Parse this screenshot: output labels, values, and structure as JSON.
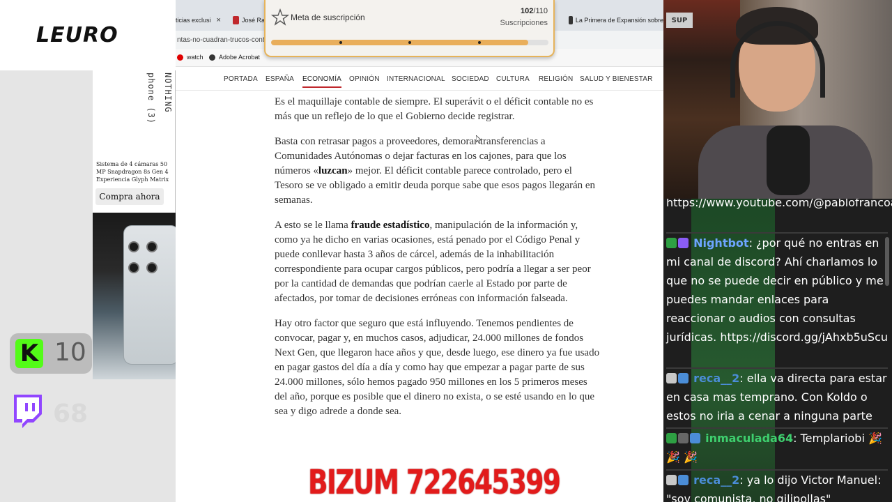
{
  "overlay": {
    "logo": "LEURO",
    "ad": {
      "vertical_text_1": "phone (3)",
      "vertical_text_2": "NOTHING",
      "description": "Sistema de 4 cámaras 50 MP Snapdragon 8s Gen 4 Experiencia Glyph Matrix",
      "cta": "Compra ahora"
    },
    "kick": {
      "icon": "kick-logo",
      "letter": "K",
      "count": "10",
      "color": "#53fc18"
    },
    "twitch": {
      "icon": "twitch-logo",
      "count": "68",
      "color": "#9146ff"
    },
    "bizum": "BIZUM 722645399"
  },
  "browser": {
    "tabs": [
      {
        "label": "ticias exclusi",
        "close": "×"
      },
      {
        "label": "José Ra",
        "favicon_color": "#c0282d"
      },
      {
        "label": "La Primera de Expansión sobre",
        "favicon_color": "#333333"
      }
    ],
    "url": "ntas-no-cuadran-trucos-contab",
    "bookmarks": [
      {
        "label": "watch",
        "icon": "youtube-icon",
        "color": "#e00000"
      },
      {
        "label": "Adobe Acrobat",
        "icon": "acrobat-icon",
        "color": "#333333"
      }
    ]
  },
  "site_nav": [
    "PORTADA",
    "ESPAÑA",
    "ECONOMÍA",
    "OPINIÓN",
    "INTERNACIONAL",
    "SOCIEDAD",
    "CULTURA",
    "RELIGIÓN",
    "SALUD Y BIENESTAR"
  ],
  "site_nav_active": "ECONOMÍA",
  "article": {
    "p1": "Es el maquillaje contable de siempre. El superávit o el déficit contable no es más que un reflejo de lo que el Gobierno decide registrar.",
    "p2_a": "Basta con retrasar pagos a proveedores, demorar transferencias a Comunidades Autónomas o dejar facturas en los cajones, para que los números «",
    "p2_b": "luzcan",
    "p2_c": "» mejor. El déficit contable parece controlado, pero el Tesoro se ve obligado a emitir deuda porque sabe que esos pagos llegarán en semanas.",
    "p3_a": "A esto se le llama ",
    "p3_b": "fraude estadístico",
    "p3_c": ", manipulación de la información y, como ya he dicho en varias ocasiones, está penado por el Código Penal y puede conllevar hasta 3 años de cárcel, además de la inhabilitación correspondiente para ocupar cargos públicos, pero podría a llegar a ser peor por la cantidad de demandas que podrían caerle al Estado por parte de afectados, por tomar de decisiones erróneas con información falseada.",
    "p4": "Hay otro factor que seguro que está influyendo. Tenemos pendientes de convocar, pagar y, en muchos casos, adjudicar, 24.000 millones de fondos Next Gen, que llegaron hace años y que, desde luego, ese dinero ya fue usado en pagar gastos del día a día y como hay que empezar a pagar parte de sus 24.000 millones, sólo hemos pagado 950 millones en los 5 primeros meses del año, porque es posible que el dinero no exista, o se esté usando en lo que sea y digo adrede a donde sea."
  },
  "goal": {
    "title": "Meta de suscripción",
    "current": "102",
    "target": "/110",
    "unit": "Suscripciones",
    "progress": 0.927,
    "bar_color": "#e9ae5b",
    "milestones": [
      0.25,
      0.5,
      0.75
    ]
  },
  "webcam": {
    "sign": "SUP"
  },
  "chat": {
    "messages": [
      {
        "text": "https://www.youtube.com/@pablofrancoabogado"
      },
      {
        "user": "Nightbot",
        "user_color": "#6da5ff",
        "text": ": ¿por qué no entras en mi canal de discord? Ahí charlamos lo que no se puede decir en público y me puedes mandar enlaces para reaccionar o audios con consultas jurídicas. https://discord.gg/jAhxb5uScu"
      },
      {
        "user": "reca__2",
        "user_color": "#4b8dd8",
        "text": ": ella va directa para estar en casa mas temprano. Con Koldo o estos no iria a cenar a ninguna parte"
      },
      {
        "user": "inmaculada64",
        "user_color": "#3ecf6e",
        "text": ": Templariobi 🎉 🎉 🎉"
      },
      {
        "user": "reca__2",
        "user_color": "#4b8dd8",
        "text": ": ya lo dijo Victor Manuel: \"soy comunista, no gilipollas\""
      }
    ]
  }
}
